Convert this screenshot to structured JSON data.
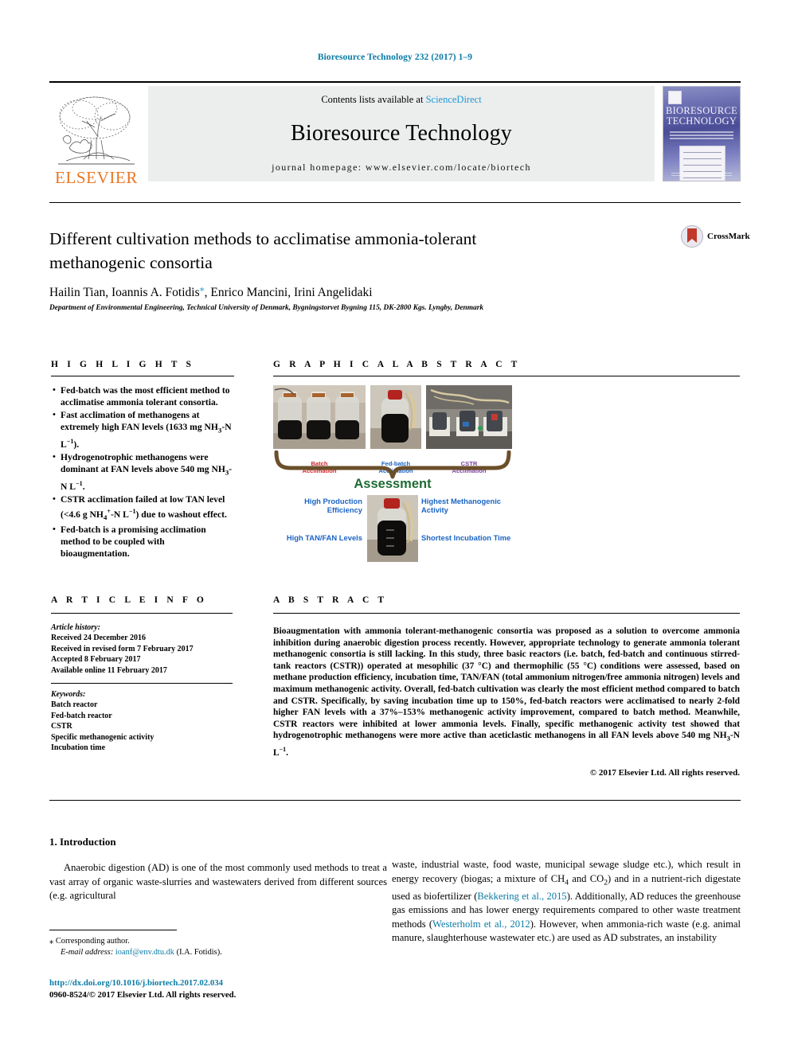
{
  "running_head": "Bioresource Technology 232 (2017) 1–9",
  "masthead": {
    "publisher": "ELSEVIER",
    "contents_prefix": "Contents lists available at ",
    "contents_link": "ScienceDirect",
    "journal_title": "Bioresource Technology",
    "homepage": "journal homepage: www.elsevier.com/locate/biortech",
    "cover_title_line1": "BIORESOURCE",
    "cover_title_line2": "TECHNOLOGY"
  },
  "crossmark": {
    "label": "CrossMark"
  },
  "article": {
    "title": "Different cultivation methods to acclimatise ammonia-tolerant methanogenic consortia",
    "authors": "Hailin Tian, Ioannis A. Fotidis",
    "authors_rest": ", Enrico Mancini, Irini Angelidaki",
    "affiliation": "Department of Environmental Engineering, Technical University of Denmark, Bygningstorvet Bygning 115, DK-2800 Kgs. Lyngby, Denmark"
  },
  "headings": {
    "highlights": "H I G H L I G H T S",
    "graphical_abstract": "G R A P H I C A L   A B S T R A C T",
    "article_info": "A R T I C L E   I N F O",
    "abstract": "A B S T R A C T"
  },
  "highlights": [
    "Fed-batch was the most efficient method to acclimatise ammonia tolerant consortia.",
    "Fast acclimation of methanogens at extremely high FAN levels (1633 mg NH3-N L−1).",
    "Hydrogenotrophic methanogens were dominant at FAN levels above 540 mg NH3-N L−1.",
    "CSTR acclimation failed at low TAN level (<4.6 g NH4+-N L−1) due to washout effect.",
    "Fed-batch is a promising acclimation method to be coupled with bioaugmentation."
  ],
  "article_info": {
    "history_label": "Article history:",
    "history": [
      "Received 24 December 2016",
      "Received in revised form 7 February 2017",
      "Accepted 8 February 2017",
      "Available online 11 February 2017"
    ],
    "keywords_label": "Keywords:",
    "keywords": [
      "Batch reactor",
      "Fed-batch reactor",
      "CSTR",
      "Specific methanogenic activity",
      "Incubation time"
    ]
  },
  "abstract_text": "Bioaugmentation with ammonia tolerant-methanogenic consortia was proposed as a solution to overcome ammonia inhibition during anaerobic digestion process recently. However, appropriate technology to generate ammonia tolerant methanogenic consortia is still lacking. In this study, three basic reactors (i.e. batch, fed-batch and continuous stirred-tank reactors (CSTR)) operated at mesophilic (37 °C) and thermophilic (55 °C) conditions were assessed, based on methane production efficiency, incubation time, TAN/FAN (total ammonium nitrogen/free ammonia nitrogen) levels and maximum methanogenic activity. Overall, fed-batch cultivation was clearly the most efficient method compared to batch and CSTR. Specifically, by saving incubation time up to 150%, fed-batch reactors were acclimatised to nearly 2-fold higher FAN levels with a 37%–153% methanogenic activity improvement, compared to batch method. Meanwhile, CSTR reactors were inhibited at lower ammonia levels. Finally, specific methanogenic activity test showed that hydrogenotrophic methanogens were more active than aceticlastic methanogens in all FAN levels above 540 mg NH3-N L−1.",
  "copyright_line": "© 2017 Elsevier Ltd. All rights reserved.",
  "graphical_abstract": {
    "captions": [
      {
        "line1": "Batch",
        "line2": "Acclimation",
        "color": "#d0262c"
      },
      {
        "line1": "Fed-batch",
        "line2": "Acclimation",
        "color": "#1b64c4"
      },
      {
        "line1": "CSTR",
        "line2": "Acclimation",
        "color": "#7b3fa0"
      }
    ],
    "assessment_label": "Assessment",
    "assessment_color": "#1f6b33",
    "outcomes": {
      "top_left": "High Production Efficiency",
      "top_right": "Highest Methanogenic Activity",
      "bottom_left": "High TAN/FAN Levels",
      "bottom_right": "Shortest Incubation Time"
    }
  },
  "body": {
    "section_title": "1. Introduction",
    "left_paragraph": "Anaerobic digestion (AD) is one of the most commonly used methods to treat a vast array of organic waste-slurries and wastewaters derived from different sources (e.g. agricultural",
    "right_paragraph_a": "waste, industrial waste, food waste, municipal sewage sludge etc.), which result in energy recovery (biogas; a mixture of CH",
    "right_sub_4": "4",
    "right_paragraph_b": " and CO",
    "right_sub_2": "2",
    "right_paragraph_c": ") and in a nutrient-rich digestate used as biofertilizer (",
    "citation_1": "Bekkering et al., 2015",
    "right_paragraph_d": "). Additionally, AD reduces the greenhouse gas emissions and has lower energy requirements compared to other waste treatment methods (",
    "citation_2": "Westerholm et al., 2012",
    "right_paragraph_e": "). However, when ammonia-rich waste (e.g. animal manure, slaughterhouse wastewater etc.) are used as AD substrates, an instability"
  },
  "footer": {
    "corresponding_marker": "⁎",
    "corresponding_author": "Corresponding author.",
    "email_label": "E-mail address:",
    "email": "ioanf@env.dtu.dk",
    "email_owner": "(I.A. Fotidis).",
    "doi": "http://dx.doi.org/10.1016/j.biortech.2017.02.034",
    "issn_line": "0960-8524/© 2017 Elsevier Ltd. All rights reserved."
  }
}
